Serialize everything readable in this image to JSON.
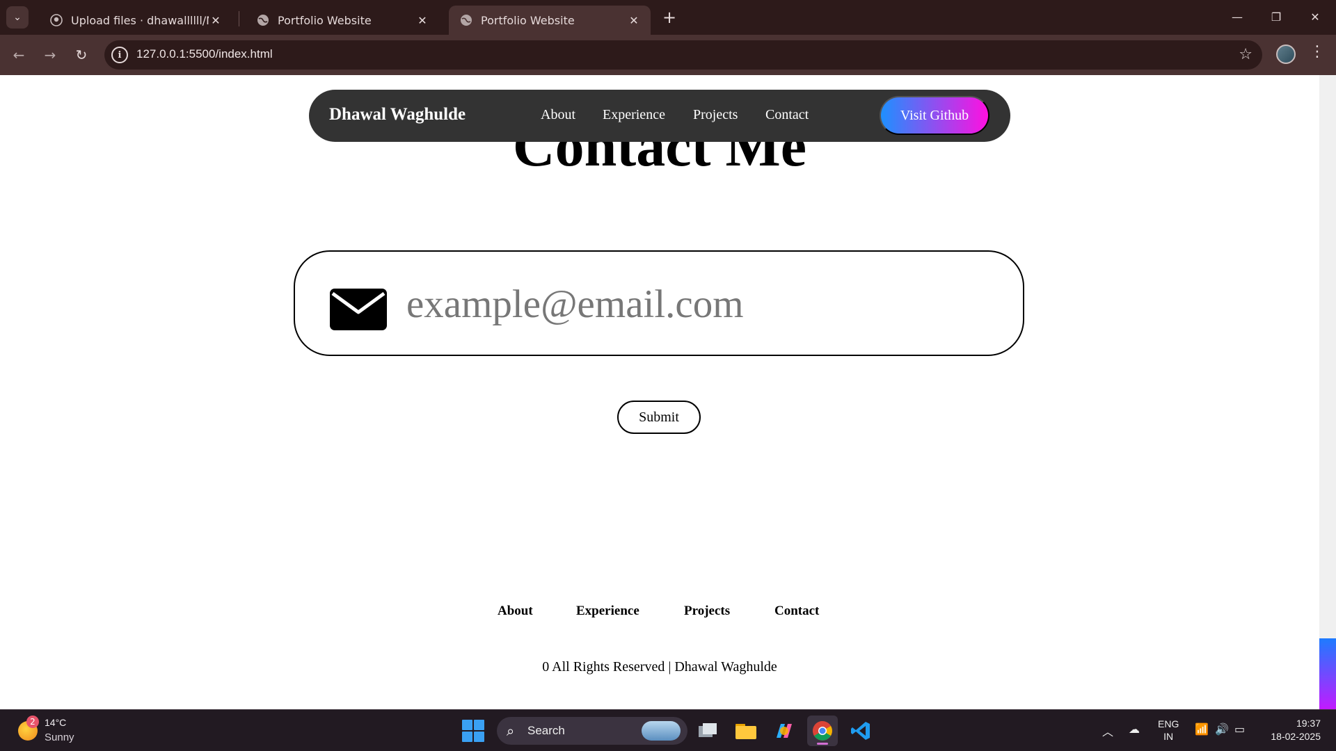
{
  "browser": {
    "tabs": [
      {
        "title": "Upload files · dhawallllll/My-Port",
        "icon": "github-icon",
        "active": false
      },
      {
        "title": "Portfolio Website",
        "icon": "globe-icon",
        "active": false
      },
      {
        "title": "Portfolio Website",
        "icon": "globe-icon",
        "active": true
      }
    ],
    "url": "127.0.0.1:5500/index.html"
  },
  "site": {
    "brand": "Dhawal Waghulde",
    "nav": [
      "About",
      "Experience",
      "Projects",
      "Contact"
    ],
    "github_button": "Visit Github",
    "heading": "Contact Me",
    "email_placeholder": "example@email.com",
    "submit_label": "Submit",
    "footer_links": [
      "About",
      "Experience",
      "Projects",
      "Contact"
    ],
    "copyright": "0 All Rights Reserved | Dhawal Waghulde",
    "accent_gradient": [
      "#1e90ff",
      "#ff10e0"
    ]
  },
  "taskbar": {
    "weather": {
      "temp": "14°C",
      "condition": "Sunny",
      "badge": "2"
    },
    "search_label": "Search",
    "language": [
      "ENG",
      "IN"
    ],
    "time": "19:37",
    "date": "18-02-2025"
  }
}
